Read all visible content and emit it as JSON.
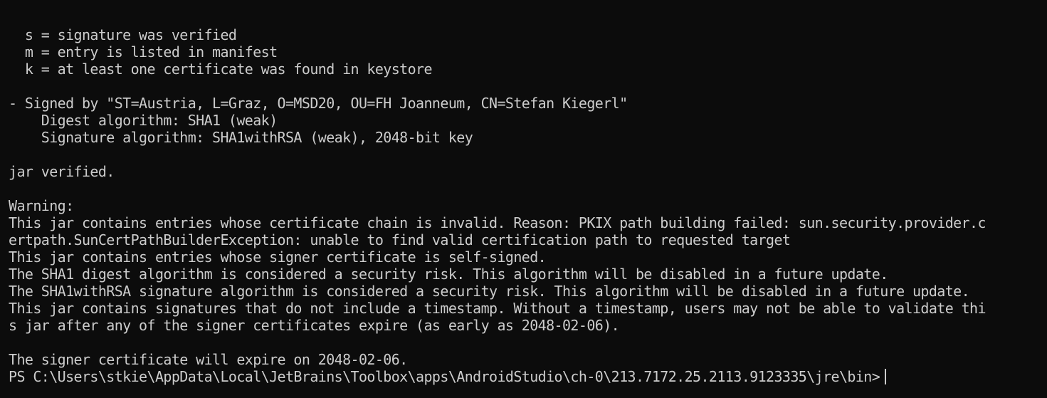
{
  "terminal": {
    "lines": [
      "",
      "  s = signature was verified",
      "  m = entry is listed in manifest",
      "  k = at least one certificate was found in keystore",
      "",
      "- Signed by \"ST=Austria, L=Graz, O=MSD20, OU=FH Joanneum, CN=Stefan Kiegerl\"",
      "    Digest algorithm: SHA1 (weak)",
      "    Signature algorithm: SHA1withRSA (weak), 2048-bit key",
      "",
      "jar verified.",
      "",
      "Warning:",
      "This jar contains entries whose certificate chain is invalid. Reason: PKIX path building failed: sun.security.provider.c",
      "ertpath.SunCertPathBuilderException: unable to find valid certification path to requested target",
      "This jar contains entries whose signer certificate is self-signed.",
      "The SHA1 digest algorithm is considered a security risk. This algorithm will be disabled in a future update.",
      "The SHA1withRSA signature algorithm is considered a security risk. This algorithm will be disabled in a future update.",
      "This jar contains signatures that do not include a timestamp. Without a timestamp, users may not be able to validate thi",
      "s jar after any of the signer certificates expire (as early as 2048-02-06).",
      "",
      "The signer certificate will expire on 2048-02-06."
    ],
    "prompt": "PS C:\\Users\\stkie\\AppData\\Local\\JetBrains\\Toolbox\\apps\\AndroidStudio\\ch-0\\213.7172.25.2113.9123335\\jre\\bin>"
  }
}
